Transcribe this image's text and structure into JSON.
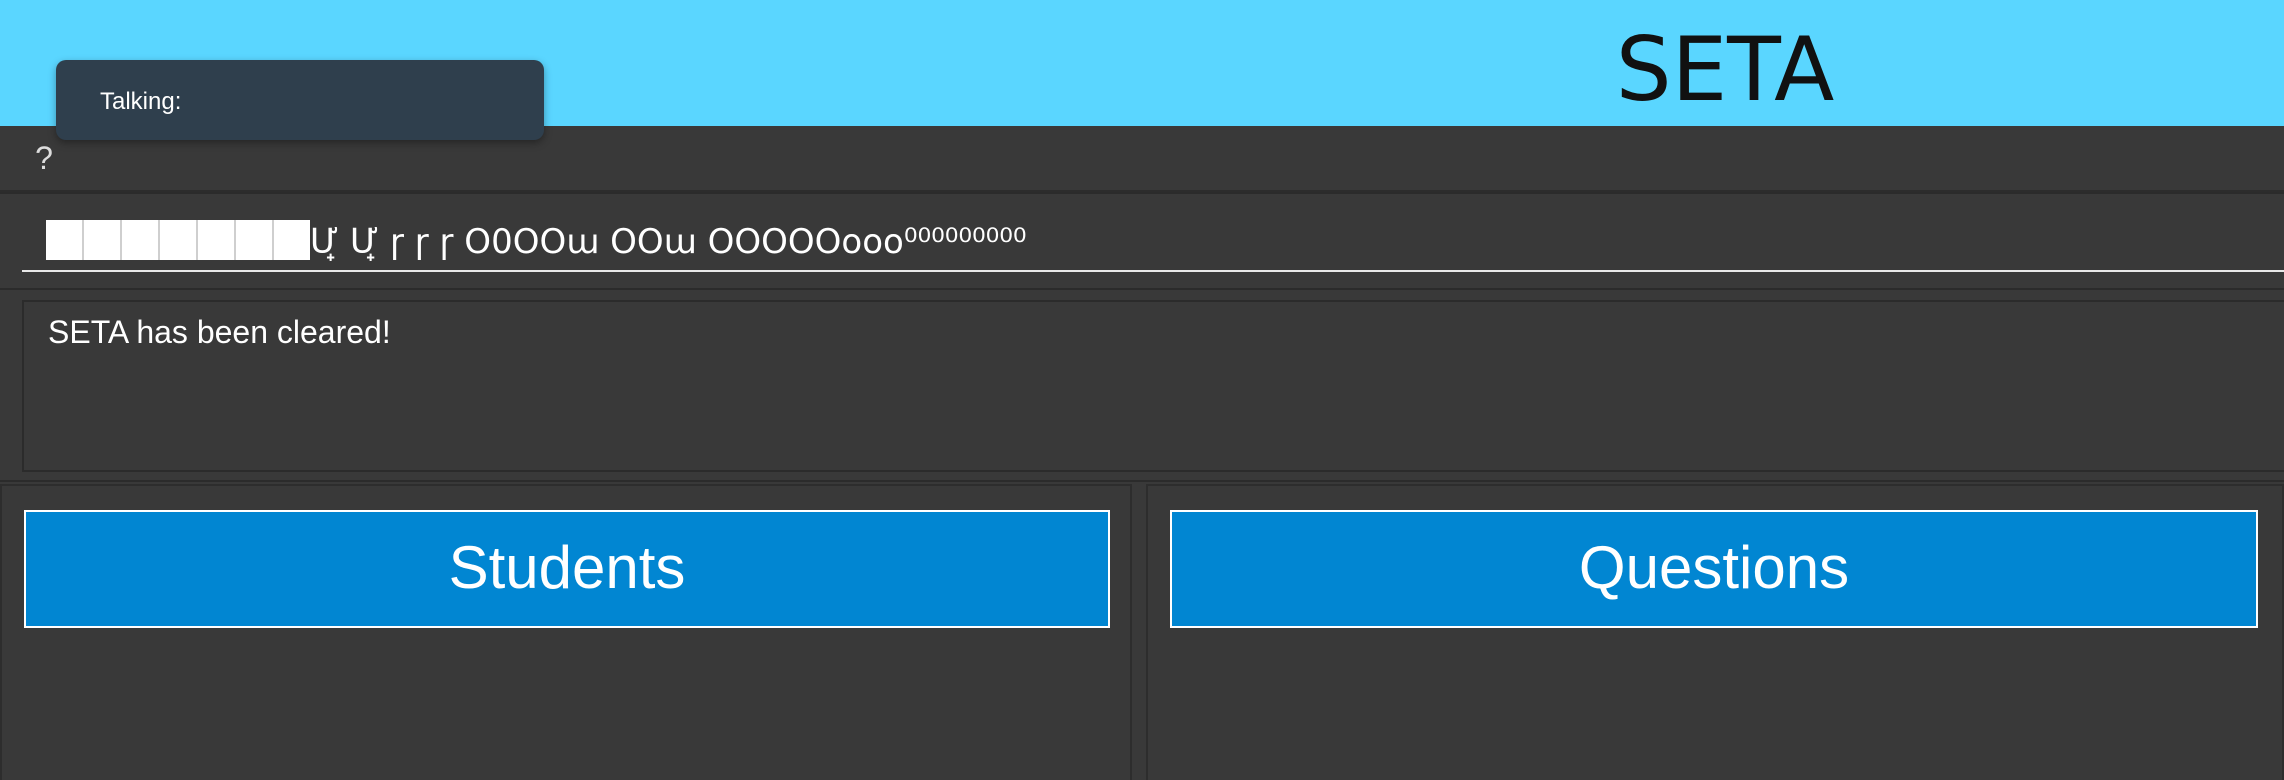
{
  "header": {
    "title": "SETA",
    "accent_color": "#5ad6ff"
  },
  "toast": {
    "text": "Talking:"
  },
  "menubar": {
    "help_label": "?"
  },
  "command": {
    "value": "Ư̟ Ư̟ ɼ ɼ ɼ O0OOɯ OOɯ OOOOOooo⁰⁰⁰⁰⁰⁰⁰⁰⁰",
    "leading_glyphs": [
      "tofu",
      "tofu",
      "tofu",
      "tofu",
      "tofu",
      "tofu",
      "tofu"
    ]
  },
  "result": {
    "text": "SETA has been cleared!"
  },
  "panels": {
    "students": {
      "title": "Students",
      "header_color": "#0186d2"
    },
    "questions": {
      "title": "Questions",
      "header_color": "#0186d2"
    }
  }
}
